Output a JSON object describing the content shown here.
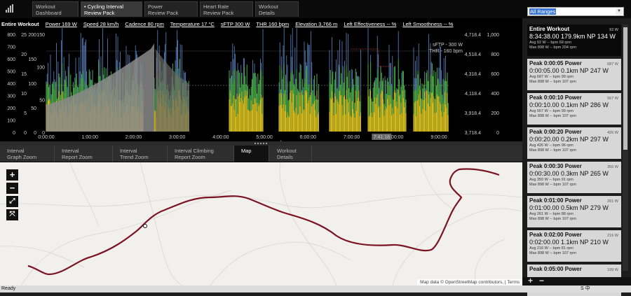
{
  "toptabs": [
    {
      "l1": "Workout",
      "l2": "Dashboard"
    },
    {
      "l1": "• Cycling Interval",
      "l2": "Review Pack"
    },
    {
      "l1": "Power",
      "l2": "Review Pack"
    },
    {
      "l1": "Heart Rate",
      "l2": "Review Pack"
    },
    {
      "l1": "Workout",
      "l2": "Details"
    }
  ],
  "stats": {
    "label": "Entire Workout",
    "items": [
      "Power 169 W",
      "Speed 28 km/h",
      "Cadence 80 rpm",
      "Temperature 17 °C",
      "sFTP 300 W",
      "THR 160 bpm",
      "Elevation 3,766 m",
      "Left Effectiveness -- %",
      "Left Smoothness -- %"
    ]
  },
  "chart_data": {
    "type": "line",
    "xlabel": "h:m:s",
    "x_ticks": [
      "0:00:00",
      "1:00:00",
      "2:00:00",
      "3:00:00",
      "4:00:00",
      "5:00:00",
      "6:00:00",
      "7:00:00",
      "8:00:00",
      "9:00:00"
    ],
    "cursor_label": "7:41:18",
    "ref_labels": [
      "sFTP - 300 W",
      "THR - 160 bpm"
    ],
    "y_axes": [
      {
        "ticks": [
          "800",
          "700",
          "600",
          "500",
          "400",
          "300",
          "200",
          "100",
          "0"
        ]
      },
      {
        "ticks": [
          "25",
          "20",
          "15",
          "10",
          "5",
          "0"
        ]
      },
      {
        "ticks": [
          "200",
          "150",
          "100",
          "50",
          "0"
        ]
      },
      {
        "ticks": [
          "150",
          "100",
          "50",
          "0"
        ]
      },
      {
        "ticks": [
          "4,718.4",
          "4,518.4",
          "4,318.4",
          "4,118.4",
          "3,918.4",
          "3,718.4"
        ]
      },
      {
        "ticks": [
          "1,000",
          "800",
          "600",
          "400",
          "200",
          "0"
        ]
      }
    ],
    "series": []
  },
  "bottomtabs": [
    {
      "l1": "Interval",
      "l2": "Graph Zoom"
    },
    {
      "l1": "Interval",
      "l2": "Report Zoom"
    },
    {
      "l1": "Interval",
      "l2": "Trend Zoom"
    },
    {
      "l1": "Interval Climbing",
      "l2": "Report Zoom"
    },
    {
      "l1": "Map",
      "l2": ""
    },
    {
      "l1": "Workout",
      "l2": "Details"
    }
  ],
  "map": {
    "attribution": "Map data © OpenStreetMap contributors, | Terms",
    "zoom_in": "+",
    "zoom_out": "−",
    "fit": "⤢",
    "full": "⤧",
    "route_color": "#7a1422"
  },
  "range_select": "All Ranges",
  "cards": [
    {
      "title": "Entire Workout",
      "corner": "92 W",
      "big": "8:34:38.00   179.9km   NP 134 W",
      "r1": "Avg  92 W   -- bpm  69 rpm",
      "r2": "Max 898 W   -- bpm 204 rpm"
    },
    {
      "title": "Peak 0:00:05 Power",
      "corner": "687 W",
      "big": "0:00:05.00   0.1km   NP 247 W",
      "r1": "Avg  687 W  -- bpm  99 rpm",
      "r2": "Max  898 W  -- bpm 107 rpm"
    },
    {
      "title": "Peak 0:00:10 Power",
      "corner": "567 W",
      "big": "0:00:10.00   0.1km   NP 286 W",
      "r1": "Avg  567 W  -- bpm  99 rpm",
      "r2": "Max  898 W  -- bpm 107 rpm"
    },
    {
      "title": "Peak 0:00:20 Power",
      "corner": "426 W",
      "big": "0:00:20.00   0.2km   NP 297 W",
      "r1": "Avg  426 W  -- bpm  96 rpm",
      "r2": "Max  898 W  -- bpm 107 rpm"
    },
    {
      "title": "Peak 0:00:30 Power",
      "corner": "350 W",
      "big": "0:00:30.00   0.3km   NP 265 W",
      "r1": "Avg  350 W  -- bpm  91 rpm",
      "r2": "Max  898 W  -- bpm 107 rpm"
    },
    {
      "title": "Peak 0:01:00 Power",
      "corner": "261 W",
      "big": "0:01:00.00   0.5km   NP 279 W",
      "r1": "Avg  261 W  -- bpm  88 rpm",
      "r2": "Max  898 W  -- bpm 107 rpm"
    },
    {
      "title": "Peak 0:02:00 Power",
      "corner": "216 W",
      "big": "0:02:00.00   1.1km   NP 210 W",
      "r1": "Avg  216 W  -- bpm  81 rpm",
      "r2": "Max  898 W  -- bpm 107 rpm"
    },
    {
      "title": "Peak 0:05:00 Power",
      "corner": "199 W",
      "big": "",
      "r1": "",
      "r2": ""
    }
  ],
  "footer": {
    "add": "+",
    "remove": "−"
  },
  "status": "Ready",
  "ime": "S 中"
}
